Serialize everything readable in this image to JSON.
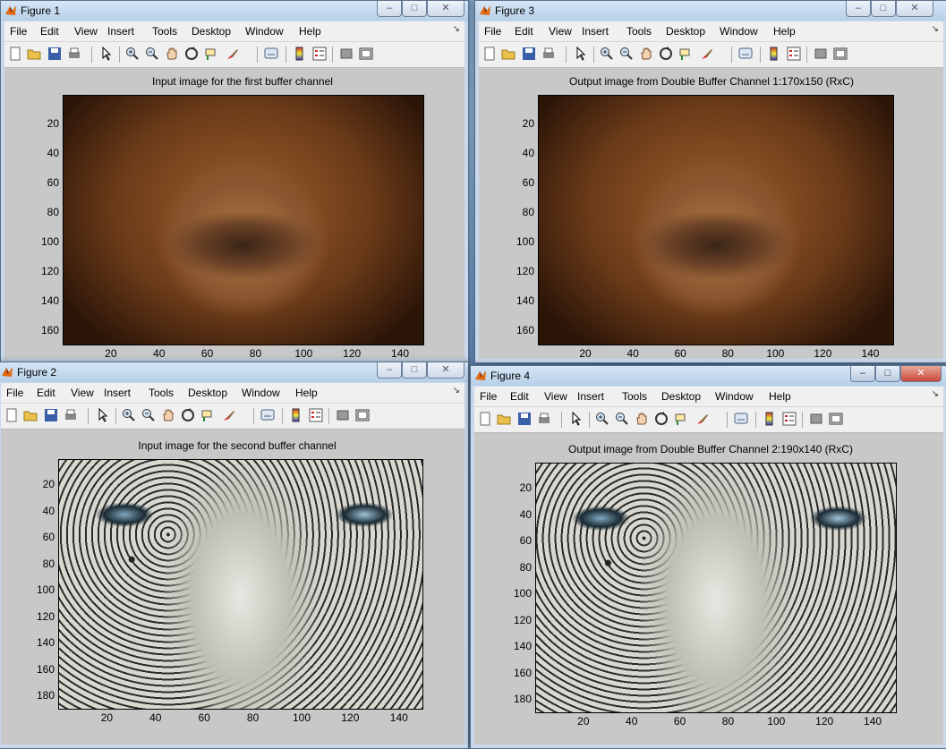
{
  "menu": [
    "File",
    "Edit",
    "View",
    "Insert",
    "Tools",
    "Desktop",
    "Window",
    "Help"
  ],
  "icons": [
    "new-figure-icon",
    "open-icon",
    "save-icon",
    "print-icon",
    "edit-plot-icon",
    "zoom-in-icon",
    "zoom-out-icon",
    "pan-icon",
    "rotate-3d-icon",
    "data-cursor-icon",
    "brush-icon",
    "link-plot-icon",
    "colorbar-icon",
    "legend-icon",
    "hide-plot-tools-icon",
    "show-plot-tools-icon"
  ],
  "windows": {
    "fig1": {
      "title": "Figure 1",
      "axes_title": "Input image for the first buffer channel",
      "yticks": [
        "20",
        "40",
        "60",
        "80",
        "100",
        "120",
        "140",
        "160"
      ],
      "xticks": [
        "20",
        "40",
        "60",
        "80",
        "100",
        "120",
        "140"
      ]
    },
    "fig3": {
      "title": "Figure 3",
      "axes_title": "Output image from Double Buffer Channel 1:170x150 (RxC)",
      "yticks": [
        "20",
        "40",
        "60",
        "80",
        "100",
        "120",
        "140",
        "160"
      ],
      "xticks": [
        "20",
        "40",
        "60",
        "80",
        "100",
        "120",
        "140"
      ]
    },
    "fig2": {
      "title": "Figure 2",
      "axes_title": "Input image for the second buffer channel",
      "yticks": [
        "20",
        "40",
        "60",
        "80",
        "100",
        "120",
        "140",
        "160",
        "180"
      ],
      "xticks": [
        "20",
        "40",
        "60",
        "80",
        "100",
        "120",
        "140"
      ]
    },
    "fig4": {
      "title": "Figure 4",
      "axes_title": "Output image from Double Buffer Channel 2:190x140 (RxC)",
      "yticks": [
        "20",
        "40",
        "60",
        "80",
        "100",
        "120",
        "140",
        "160",
        "180"
      ],
      "xticks": [
        "20",
        "40",
        "60",
        "80",
        "100",
        "120",
        "140"
      ]
    }
  },
  "controls": {
    "minimize": "–",
    "maximize": "□",
    "close": "✕"
  }
}
